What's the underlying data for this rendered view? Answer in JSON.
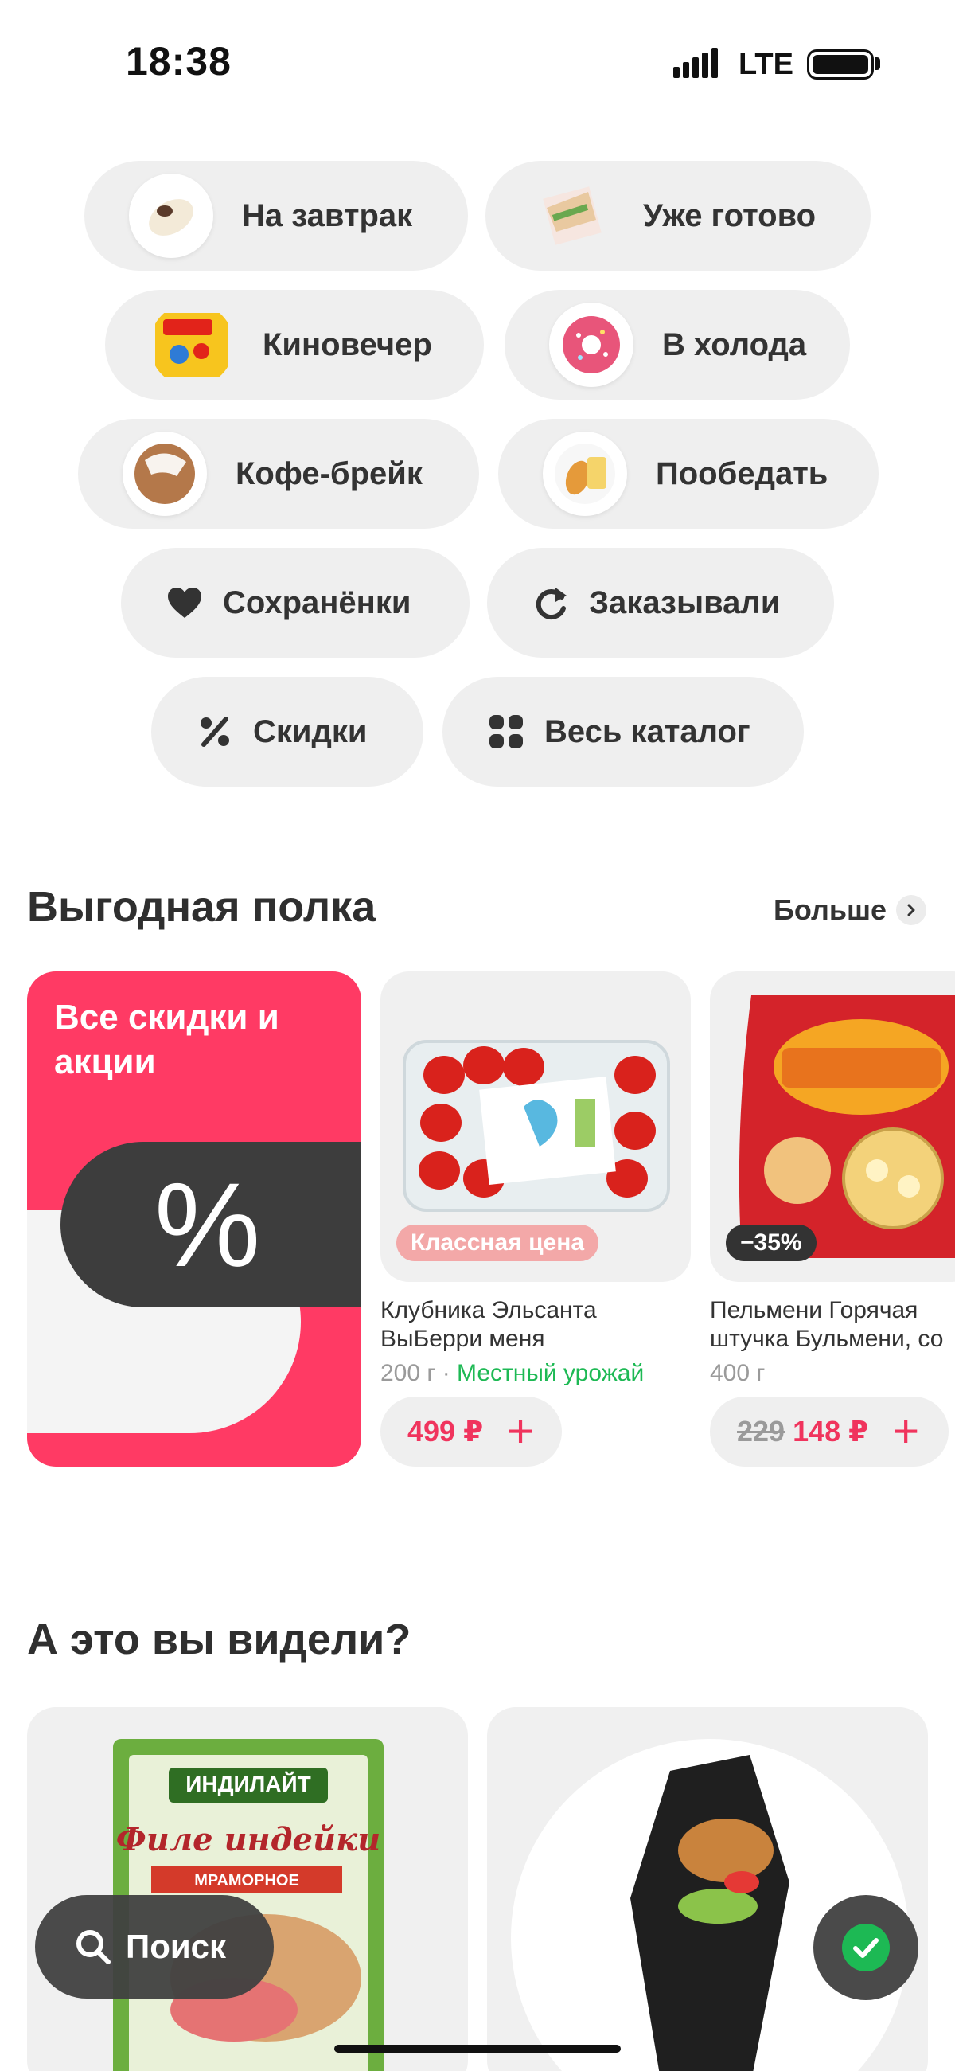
{
  "status_bar": {
    "time": "18:38",
    "network": "LTE"
  },
  "categories": [
    {
      "label": "На завтрак",
      "icon": "breakfast-wrap-thumb"
    },
    {
      "label": "Уже готово",
      "icon": "sandwich-box-thumb"
    },
    {
      "label": "Киновечер",
      "icon": "candy-pack-thumb"
    },
    {
      "label": "В холода",
      "icon": "donut-thumb"
    },
    {
      "label": "Кофе-брейк",
      "icon": "pastry-thumb"
    },
    {
      "label": "Пообедать",
      "icon": "lunch-plate-thumb"
    },
    {
      "label": "Сохранёнки",
      "icon": "heart-icon"
    },
    {
      "label": "Заказывали",
      "icon": "refresh-icon"
    },
    {
      "label": "Скидки",
      "icon": "percent-icon"
    },
    {
      "label": "Весь каталог",
      "icon": "grid-icon"
    }
  ],
  "deals": {
    "title": "Выгодная полка",
    "more_label": "Больше",
    "promo": {
      "title": "Все скидки и акции",
      "symbol": "%"
    },
    "products": [
      {
        "name_line1": "Клубника Эльсанта",
        "name_line2": "ВыБерри меня",
        "weight": "200 г",
        "separator": "·",
        "origin": "Местный урожай",
        "badge": "Классная цена",
        "price": "499 ₽",
        "old_price": ""
      },
      {
        "name_line1": "Пельмени Горячая",
        "name_line2": "штучка Бульмени, со",
        "weight": "400 г",
        "badge": "−35%",
        "old_price": "229",
        "price": "148 ₽"
      }
    ],
    "add_symbol": "+"
  },
  "seen": {
    "title": "А это вы видели?"
  },
  "floating": {
    "search_label": "Поиск"
  },
  "colors": {
    "accent": "#f0345d",
    "promo_bg": "#ff3a64",
    "success": "#1db954"
  }
}
